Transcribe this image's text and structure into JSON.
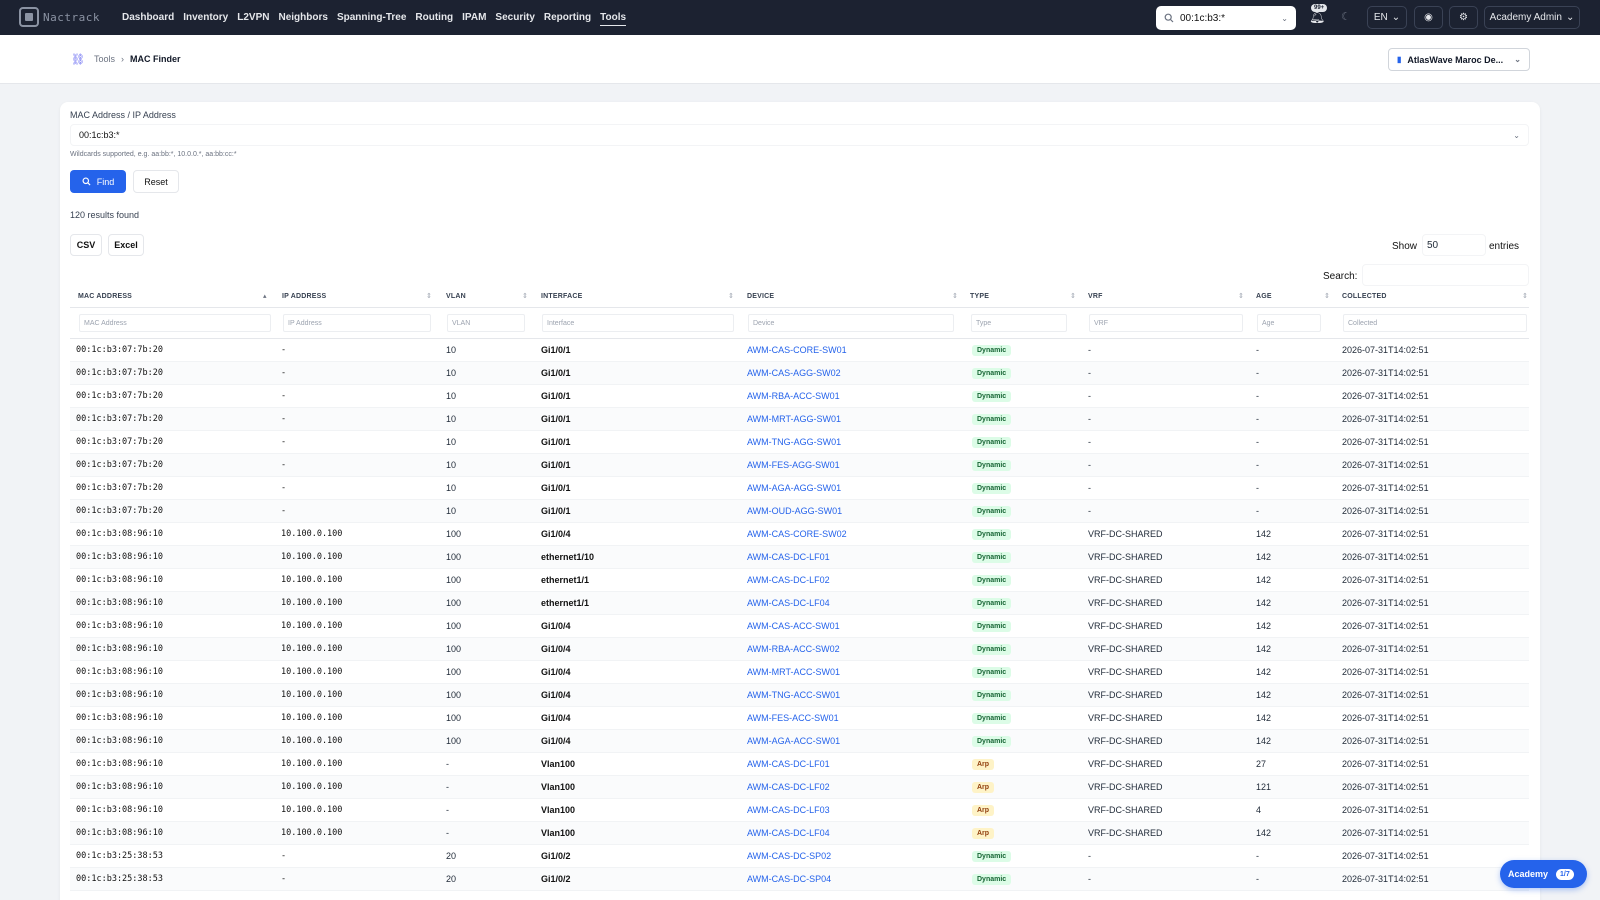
{
  "nav": {
    "logo_text": "Nactrack",
    "links": [
      "Dashboard",
      "Inventory",
      "L2VPN",
      "Neighbors",
      "Spanning-Tree",
      "Routing",
      "IPAM",
      "Security",
      "Reporting",
      "Tools"
    ],
    "active": "Tools",
    "search_value": "00:1c:b3:*",
    "notif_badge": "99+",
    "lang": "EN",
    "user": "Academy Admin"
  },
  "breadcrumb": {
    "parent": "Tools",
    "current": "MAC Finder"
  },
  "tenant": "AtlasWave Maroc De...",
  "form": {
    "label": "MAC Address / IP Address",
    "value": "00:1c:b3:*",
    "hint": "Wildcards supported, e.g. aa:bb:*, 10.0.0.*, aa:bb:cc:*",
    "find_label": "Find",
    "reset_label": "Reset"
  },
  "results_text": "120 results found",
  "export": {
    "csv": "CSV",
    "excel": "Excel"
  },
  "show": {
    "label": "Show",
    "value": "50",
    "suffix": "entries"
  },
  "search_label": "Search:",
  "table": {
    "columns": [
      "MAC ADDRESS",
      "IP ADDRESS",
      "VLAN",
      "INTERFACE",
      "DEVICE",
      "TYPE",
      "VRF",
      "AGE",
      "COLLECTED"
    ],
    "filters": [
      "MAC Address",
      "IP Address",
      "VLAN",
      "Interface",
      "Device",
      "Type",
      "VRF",
      "Age",
      "Collected"
    ],
    "rows": [
      [
        "00:1c:b3:07:7b:20",
        "-",
        "10",
        "Gi1/0/1",
        "AWM-CAS-CORE-SW01",
        "Dynamic",
        "-",
        "-",
        "2026-07-31T14:02:51"
      ],
      [
        "00:1c:b3:07:7b:20",
        "-",
        "10",
        "Gi1/0/1",
        "AWM-CAS-AGG-SW02",
        "Dynamic",
        "-",
        "-",
        "2026-07-31T14:02:51"
      ],
      [
        "00:1c:b3:07:7b:20",
        "-",
        "10",
        "Gi1/0/1",
        "AWM-RBA-ACC-SW01",
        "Dynamic",
        "-",
        "-",
        "2026-07-31T14:02:51"
      ],
      [
        "00:1c:b3:07:7b:20",
        "-",
        "10",
        "Gi1/0/1",
        "AWM-MRT-AGG-SW01",
        "Dynamic",
        "-",
        "-",
        "2026-07-31T14:02:51"
      ],
      [
        "00:1c:b3:07:7b:20",
        "-",
        "10",
        "Gi1/0/1",
        "AWM-TNG-AGG-SW01",
        "Dynamic",
        "-",
        "-",
        "2026-07-31T14:02:51"
      ],
      [
        "00:1c:b3:07:7b:20",
        "-",
        "10",
        "Gi1/0/1",
        "AWM-FES-AGG-SW01",
        "Dynamic",
        "-",
        "-",
        "2026-07-31T14:02:51"
      ],
      [
        "00:1c:b3:07:7b:20",
        "-",
        "10",
        "Gi1/0/1",
        "AWM-AGA-AGG-SW01",
        "Dynamic",
        "-",
        "-",
        "2026-07-31T14:02:51"
      ],
      [
        "00:1c:b3:07:7b:20",
        "-",
        "10",
        "Gi1/0/1",
        "AWM-OUD-AGG-SW01",
        "Dynamic",
        "-",
        "-",
        "2026-07-31T14:02:51"
      ],
      [
        "00:1c:b3:08:96:10",
        "10.100.0.100",
        "100",
        "Gi1/0/4",
        "AWM-CAS-CORE-SW02",
        "Dynamic",
        "VRF-DC-SHARED",
        "142",
        "2026-07-31T14:02:51"
      ],
      [
        "00:1c:b3:08:96:10",
        "10.100.0.100",
        "100",
        "ethernet1/10",
        "AWM-CAS-DC-LF01",
        "Dynamic",
        "VRF-DC-SHARED",
        "142",
        "2026-07-31T14:02:51"
      ],
      [
        "00:1c:b3:08:96:10",
        "10.100.0.100",
        "100",
        "ethernet1/1",
        "AWM-CAS-DC-LF02",
        "Dynamic",
        "VRF-DC-SHARED",
        "142",
        "2026-07-31T14:02:51"
      ],
      [
        "00:1c:b3:08:96:10",
        "10.100.0.100",
        "100",
        "ethernet1/1",
        "AWM-CAS-DC-LF04",
        "Dynamic",
        "VRF-DC-SHARED",
        "142",
        "2026-07-31T14:02:51"
      ],
      [
        "00:1c:b3:08:96:10",
        "10.100.0.100",
        "100",
        "Gi1/0/4",
        "AWM-CAS-ACC-SW01",
        "Dynamic",
        "VRF-DC-SHARED",
        "142",
        "2026-07-31T14:02:51"
      ],
      [
        "00:1c:b3:08:96:10",
        "10.100.0.100",
        "100",
        "Gi1/0/4",
        "AWM-RBA-ACC-SW02",
        "Dynamic",
        "VRF-DC-SHARED",
        "142",
        "2026-07-31T14:02:51"
      ],
      [
        "00:1c:b3:08:96:10",
        "10.100.0.100",
        "100",
        "Gi1/0/4",
        "AWM-MRT-ACC-SW01",
        "Dynamic",
        "VRF-DC-SHARED",
        "142",
        "2026-07-31T14:02:51"
      ],
      [
        "00:1c:b3:08:96:10",
        "10.100.0.100",
        "100",
        "Gi1/0/4",
        "AWM-TNG-ACC-SW01",
        "Dynamic",
        "VRF-DC-SHARED",
        "142",
        "2026-07-31T14:02:51"
      ],
      [
        "00:1c:b3:08:96:10",
        "10.100.0.100",
        "100",
        "Gi1/0/4",
        "AWM-FES-ACC-SW01",
        "Dynamic",
        "VRF-DC-SHARED",
        "142",
        "2026-07-31T14:02:51"
      ],
      [
        "00:1c:b3:08:96:10",
        "10.100.0.100",
        "100",
        "Gi1/0/4",
        "AWM-AGA-ACC-SW01",
        "Dynamic",
        "VRF-DC-SHARED",
        "142",
        "2026-07-31T14:02:51"
      ],
      [
        "00:1c:b3:08:96:10",
        "10.100.0.100",
        "-",
        "Vlan100",
        "AWM-CAS-DC-LF01",
        "Arp",
        "VRF-DC-SHARED",
        "27",
        "2026-07-31T14:02:51"
      ],
      [
        "00:1c:b3:08:96:10",
        "10.100.0.100",
        "-",
        "Vlan100",
        "AWM-CAS-DC-LF02",
        "Arp",
        "VRF-DC-SHARED",
        "121",
        "2026-07-31T14:02:51"
      ],
      [
        "00:1c:b3:08:96:10",
        "10.100.0.100",
        "-",
        "Vlan100",
        "AWM-CAS-DC-LF03",
        "Arp",
        "VRF-DC-SHARED",
        "4",
        "2026-07-31T14:02:51"
      ],
      [
        "00:1c:b3:08:96:10",
        "10.100.0.100",
        "-",
        "Vlan100",
        "AWM-CAS-DC-LF04",
        "Arp",
        "VRF-DC-SHARED",
        "142",
        "2026-07-31T14:02:51"
      ],
      [
        "00:1c:b3:25:38:53",
        "-",
        "20",
        "Gi1/0/2",
        "AWM-CAS-DC-SP02",
        "Dynamic",
        "-",
        "-",
        "2026-07-31T14:02:51"
      ],
      [
        "00:1c:b3:25:38:53",
        "-",
        "20",
        "Gi1/0/2",
        "AWM-CAS-DC-SP04",
        "Dynamic",
        "-",
        "-",
        "2026-07-31T14:02:51"
      ]
    ]
  },
  "academy": {
    "label": "Academy",
    "badge": "1/7"
  },
  "colors": {
    "nav_bg": "#1c2231",
    "accent": "#2563eb",
    "dynamic_bg": "#dcfce7",
    "arp_bg": "#fef3c7"
  }
}
